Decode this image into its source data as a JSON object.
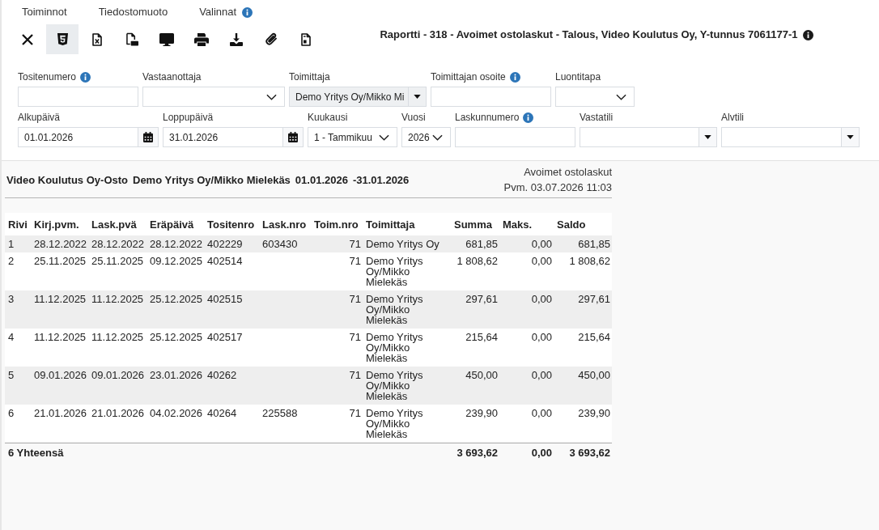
{
  "menu": [
    {
      "label": "Toiminnot",
      "info": false
    },
    {
      "label": "Tiedostomuoto",
      "info": false
    },
    {
      "label": "Valinnat",
      "info": true
    }
  ],
  "toolbar": [
    {
      "kind": "close",
      "selected": false
    },
    {
      "kind": "html",
      "selected": true
    },
    {
      "kind": "excel",
      "selected": false
    },
    {
      "kind": "pdf",
      "selected": false
    },
    {
      "kind": "screen",
      "selected": false
    },
    {
      "kind": "print",
      "selected": false
    },
    {
      "kind": "download",
      "selected": false
    },
    {
      "kind": "attachment",
      "selected": false
    },
    {
      "kind": "document",
      "selected": false
    }
  ],
  "report_title": {
    "text": "Raportti - 318 - Avoimet ostolaskut - Talous, Video Koulutus Oy, Y-tunnus 7061177-1",
    "info": true
  },
  "filter_rows": [
    {
      "fields": [
        {
          "label": "Tositenumero",
          "info": true,
          "kind": "text"
        },
        {
          "label": "Vastaanottaja",
          "info": false,
          "kind": "select"
        },
        {
          "label": "Toimittaja",
          "info": false,
          "kind": "combo",
          "value": "Demo Yritys Oy/Mikko Mi"
        },
        {
          "label": "Toimittajan osoite",
          "info": true,
          "kind": "text"
        },
        {
          "label": "Luontitapa",
          "info": false,
          "kind": "select"
        }
      ]
    },
    {
      "fields": [
        {
          "label": "Alkupäivä",
          "info": false,
          "kind": "date",
          "value": "01.01.2026"
        },
        {
          "label": "Loppupäivä",
          "info": false,
          "kind": "date",
          "value": "31.01.2026"
        },
        {
          "label": "Kuukausi",
          "info": false,
          "kind": "select",
          "value": "1 - Tammikuu"
        },
        {
          "label": "Vuosi",
          "info": false,
          "kind": "select",
          "value": "2026"
        },
        {
          "label": "Laskunnumero",
          "info": true,
          "kind": "text"
        },
        {
          "label": "Vastatili",
          "info": false,
          "kind": "combo"
        },
        {
          "label": "Alvtili",
          "info": false,
          "kind": "combo"
        }
      ]
    }
  ],
  "report": {
    "company": "Video Koulutus Oy-Osto",
    "supplier": "Demo Yritys Oy/Mikko Mielekäs",
    "start_date": "01.01.2026",
    "end_date": "-31.01.2026",
    "report_name": "Avoimet ostolaskut",
    "printed": "Pvm. 03.07.2026 11:03"
  },
  "table": {
    "columns": [
      "Rivi",
      "Kirj.pvm.",
      "Lask.pvä",
      "Eräpäivä",
      "Tositenro",
      "Lask.nro",
      "Toim.nro",
      "Toimittaja",
      "Summa",
      "Maks.",
      "Saldo"
    ],
    "rows": [
      {
        "rivi": "1",
        "kirj_pvm": "28.12.2022",
        "lask_pva": "28.12.2022",
        "erapaiva": "28.12.2022",
        "tositenro": "402229",
        "lask_nro": "603430",
        "toim_nro": "71",
        "toimittaja": "Demo Yritys Oy",
        "summa": "681,85",
        "maks": "0,00",
        "saldo": "681,85"
      },
      {
        "rivi": "2",
        "kirj_pvm": "25.11.2025",
        "lask_pva": "25.11.2025",
        "erapaiva": "09.12.2025",
        "tositenro": "402514",
        "toim_nro": "71",
        "toimittaja": "Demo Yritys Oy/Mikko Mielekäs",
        "summa": "1 808,62",
        "maks": "0,00",
        "saldo": "1 808,62"
      },
      {
        "rivi": "3",
        "kirj_pvm": "11.12.2025",
        "lask_pva": "11.12.2025",
        "erapaiva": "25.12.2025",
        "tositenro": "402515",
        "toim_nro": "71",
        "toimittaja": "Demo Yritys Oy/Mikko Mielekäs",
        "summa": "297,61",
        "maks": "0,00",
        "saldo": "297,61"
      },
      {
        "rivi": "4",
        "kirj_pvm": "11.12.2025",
        "lask_pva": "11.12.2025",
        "erapaiva": "25.12.2025",
        "tositenro": "402517",
        "toim_nro": "71",
        "toimittaja": "Demo Yritys Oy/Mikko Mielekäs",
        "summa": "215,64",
        "maks": "0,00",
        "saldo": "215,64"
      },
      {
        "rivi": "5",
        "kirj_pvm": "09.01.2026",
        "lask_pva": "09.01.2026",
        "erapaiva": "23.01.2026",
        "tositenro": "40262",
        "toim_nro": "71",
        "toimittaja": "Demo Yritys Oy/Mikko Mielekäs",
        "summa": "450,00",
        "maks": "0,00",
        "saldo": "450,00"
      },
      {
        "rivi": "6",
        "kirj_pvm": "21.01.2026",
        "lask_pva": "21.01.2026",
        "erapaiva": "04.02.2026",
        "tositenro": "40264",
        "lask_nro": "225588",
        "toim_nro": "71",
        "toimittaja": "Demo Yritys Oy/Mikko Mielekäs",
        "summa": "239,90",
        "maks": "0,00",
        "saldo": "239,90"
      }
    ],
    "total": {
      "label": "6 Yhteensä",
      "summa": "3 693,62",
      "maks": "0,00",
      "saldo": "3 693,62"
    }
  }
}
